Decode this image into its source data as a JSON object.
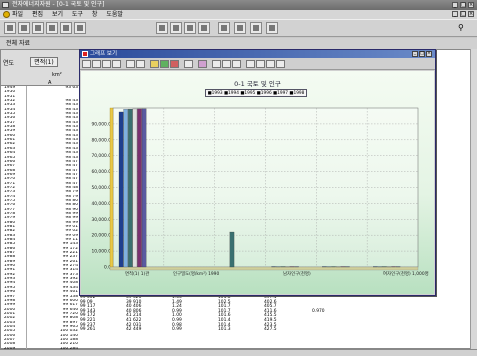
{
  "window": {
    "title": "전자에너지자원 - [0-1 국토 및 인구]",
    "menu": [
      "파일",
      "편집",
      "보기",
      "도구",
      "창",
      "도움말"
    ]
  },
  "subheader": "전체 자료",
  "table": {
    "header_year": "연도",
    "header_col1": "면적(1)",
    "unit": "km²",
    "arrow": "A",
    "years": [
      "1949",
      "1950",
      "1951",
      "1952",
      "1953",
      "1954",
      "1955",
      "1956",
      "1957",
      "1958",
      "1959",
      "1960",
      "1961",
      "1962",
      "1963",
      "1964",
      "1965",
      "1966",
      "1967",
      "1968",
      "1969",
      "1970",
      "1971",
      "1972",
      "1973",
      "1974",
      "1975",
      "1976",
      "1977",
      "1978",
      "1979",
      "1980",
      "1981",
      "1982",
      "1983",
      "1984",
      "1985",
      "1986",
      "1987",
      "1988",
      "1989",
      "1990",
      "1991",
      "1992",
      "1993",
      "1994",
      "1995",
      "1996",
      "1997",
      "1998",
      "1999",
      "2000",
      "2001",
      "2002",
      "2003",
      "2004",
      "2005",
      "2006",
      "2007",
      "2008",
      "2009"
    ],
    "values": [
      "93 63",
      "",
      "",
      "98 43",
      "98 43",
      "98 43",
      "98 43",
      "98 43",
      "98 43",
      "98 43",
      "98 43",
      "98 43",
      "98 43",
      "98 43",
      "98 43",
      "98 43",
      "98 43",
      "98 47",
      "98 47",
      "98 47",
      "98 47",
      "98 47",
      "98 47",
      "98 48",
      "98 79",
      "98 79",
      "98 80",
      "98 80",
      "98 90",
      "98 99",
      "98 99",
      "98 99",
      "99 01",
      "99 02",
      "99 09",
      "99 11",
      "99 143",
      "99 172",
      "99 221",
      "99 237",
      "99 261",
      "99 274",
      "99 314",
      "99 373",
      "99 392",
      "99 408",
      "99 434",
      "99 461",
      "99 538",
      "99 600",
      "99 617",
      "99 646",
      "99 720",
      "99 808",
      "99 897",
      "99 965",
      "100 032",
      "100 140",
      "100 188",
      "100 210",
      "100 284"
    ],
    "bottom_rows": [
      [
        "99 002",
        "39 326",
        "1.56",
        "101.8",
        "397.1",
        ""
      ],
      [
        "99 09",
        "39 910",
        "1.49",
        "102.5",
        "402.6",
        ""
      ],
      [
        "99 117",
        "40 406",
        "1.24",
        "101.7",
        "405.7",
        ""
      ],
      [
        "99 143",
        "40 806",
        "0.99",
        "101.7",
        "411.6",
        "0.970"
      ],
      [
        "99 172",
        "41 214",
        "1.00",
        "101.6",
        "415.5",
        ""
      ],
      [
        "99 221",
        "41 622",
        "0.99",
        "101.4",
        "419.5",
        ""
      ],
      [
        "99 237",
        "42 031",
        "0.98",
        "101.4",
        "423.5",
        ""
      ],
      [
        "99 261",
        "42 449",
        "0.99",
        "101.3",
        "427.5",
        ""
      ]
    ]
  },
  "graph_window": {
    "title": "그래프 보기",
    "chart_title": "0-1 국토 및 인구",
    "legend": "■1993 ■1994 ■1995 ■1996 ■1997 ■1998"
  },
  "chart_data": {
    "type": "bar",
    "title": "0-1 국토 및 인구",
    "categories": [
      "면적(1) 1)관",
      "인구밀도(명/km²)",
      "1990",
      "남자인구(천명)",
      "여자인구(천명)",
      "1,000"
    ],
    "category_labels_visible": [
      "면적(1) 1)관",
      "인구밀도(명/km²) 1990",
      "남자인구(천명)",
      "여자인구(천명) 1,000명"
    ],
    "series": [
      {
        "name": "1993",
        "color": "#1f3f8f",
        "values": [
          97500,
          0,
          0,
          300,
          300,
          300
        ]
      },
      {
        "name": "1994",
        "color": "#7fb0e0",
        "values": [
          99200,
          0,
          0,
          300,
          300,
          300
        ]
      },
      {
        "name": "1995",
        "color": "#3a7070",
        "values": [
          99300,
          0,
          22000,
          300,
          300,
          300
        ]
      },
      {
        "name": "1996",
        "color": "#e0e0e0",
        "values": [
          99400,
          0,
          0,
          300,
          300,
          300
        ]
      },
      {
        "name": "1997",
        "color": "#7a3070",
        "values": [
          99450,
          0,
          0,
          300,
          300,
          300
        ]
      },
      {
        "name": "1998",
        "color": "#5a5aa0",
        "values": [
          99500,
          0,
          0,
          300,
          300,
          300
        ]
      }
    ],
    "yticks": [
      0,
      10000,
      20000,
      30000,
      40000,
      50000,
      60000,
      70000,
      80000,
      90000
    ],
    "ylim": [
      0,
      100000
    ],
    "grid": true,
    "legend_position": "top-center"
  }
}
